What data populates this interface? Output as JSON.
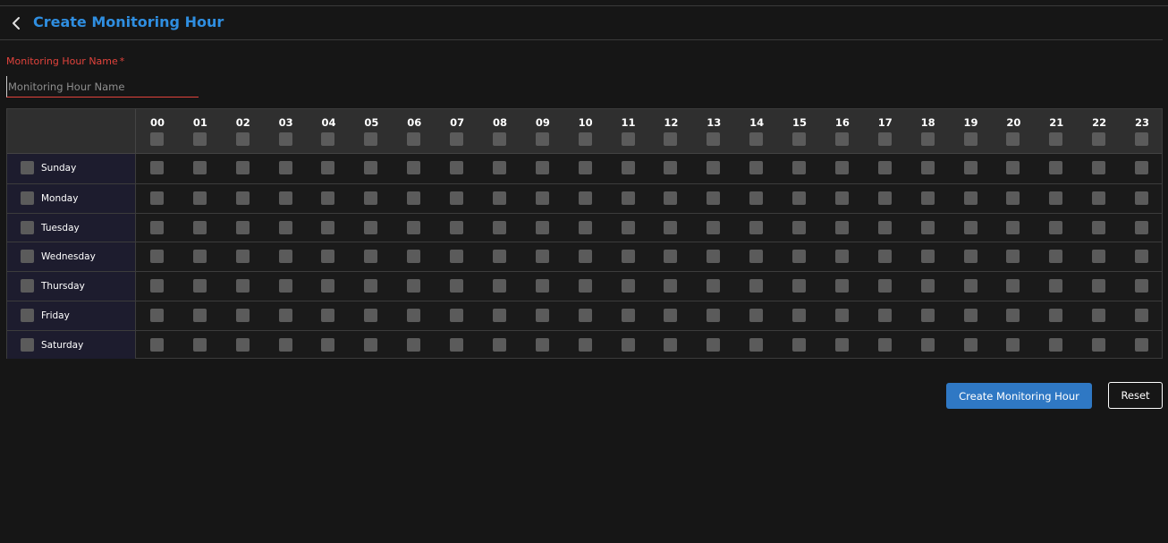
{
  "header": {
    "title": "Create Monitoring Hour",
    "back_icon": "chevron-left-icon"
  },
  "form": {
    "name_label": "Monitoring Hour Name",
    "required_mark": "*",
    "name_placeholder": "Monitoring Hour Name",
    "name_value": ""
  },
  "grid": {
    "hours": [
      "00",
      "01",
      "02",
      "03",
      "04",
      "05",
      "06",
      "07",
      "08",
      "09",
      "10",
      "11",
      "12",
      "13",
      "14",
      "15",
      "16",
      "17",
      "18",
      "19",
      "20",
      "21",
      "22",
      "23"
    ],
    "days": [
      "Sunday",
      "Monday",
      "Tuesday",
      "Wednesday",
      "Thursday",
      "Friday",
      "Saturday"
    ]
  },
  "actions": {
    "create_label": "Create Monitoring Hour",
    "reset_label": "Reset"
  },
  "colors": {
    "accent": "#2f8ee0",
    "required": "#e2433c",
    "primary_button": "#2f78c4",
    "checkbox": "#5b5b5b"
  }
}
